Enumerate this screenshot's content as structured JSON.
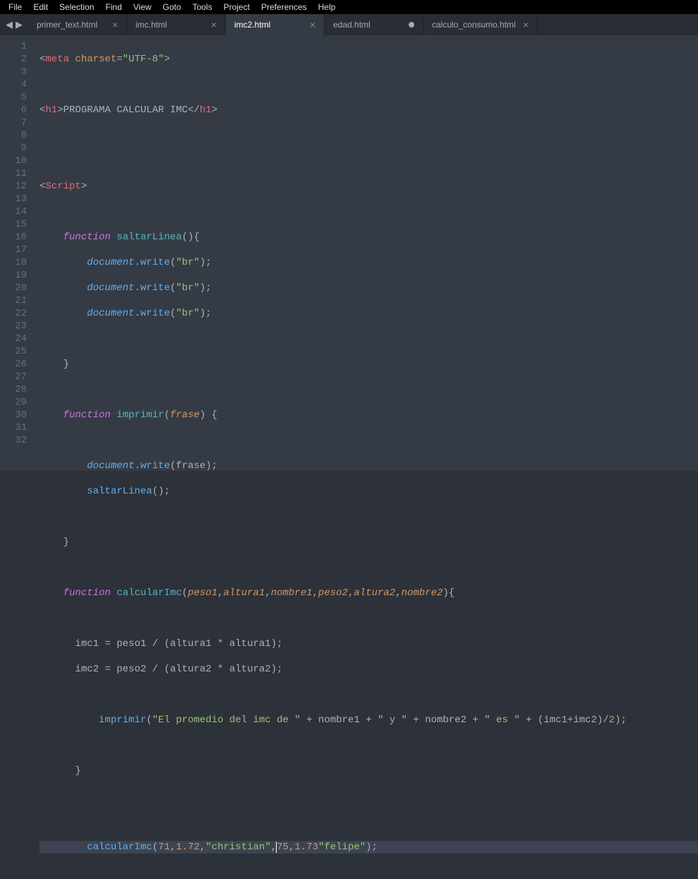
{
  "menu": {
    "items": [
      "File",
      "Edit",
      "Selection",
      "Find",
      "View",
      "Goto",
      "Tools",
      "Project",
      "Preferences",
      "Help"
    ]
  },
  "arrows": {
    "left": "◀",
    "right": "▶"
  },
  "tabs": [
    {
      "label": "primer_text.html",
      "active": false,
      "closeGlyph": "×"
    },
    {
      "label": "imc.html",
      "active": false,
      "closeGlyph": "×"
    },
    {
      "label": "imc2.html",
      "active": true,
      "closeGlyph": "×"
    },
    {
      "label": "edad.html",
      "active": false,
      "dirty": true
    },
    {
      "label": "calculo_consumo.html",
      "active": false,
      "closeGlyph": "×"
    }
  ],
  "code": {
    "ln1": {
      "tag_open": "<",
      "tag": "meta",
      "attr": "charset",
      "eq": "=",
      "q1": "\"",
      "str": "UTF-8",
      "q2": "\"",
      "tag_close": ">"
    },
    "ln3": {
      "open": "<",
      "tag": "h1",
      "bracket": ">",
      "text": "PROGRAMA CALCULAR IMC",
      "close_open": "</",
      "close_tag": "h1",
      "close_bracket": ">"
    },
    "ln6": {
      "open": "<",
      "tag": "Script",
      "bracket": ">"
    },
    "ln8": {
      "kw": "function",
      "name": "saltarLinea",
      "paren": "(){"
    },
    "ln9": {
      "obj": "document",
      "dot": ".",
      "method": "write",
      "call": "(",
      "q": "\"",
      "str": "br",
      "q2": "\"",
      "end": ");"
    },
    "ln10": {
      "obj": "document",
      "dot": ".",
      "method": "write",
      "call": "(",
      "q": "\"",
      "str": "br",
      "q2": "\"",
      "end": ");"
    },
    "ln11": {
      "obj": "document",
      "dot": ".",
      "method": "write",
      "call": "(",
      "q": "\"",
      "str": "br",
      "q2": "\"",
      "end": ");"
    },
    "ln13": {
      "brace": "}"
    },
    "ln15": {
      "kw": "function",
      "name": "imprimir",
      "open": "(",
      "param": "frase",
      "close": ") {"
    },
    "ln17": {
      "obj": "document",
      "dot": ".",
      "method": "write",
      "open": "(",
      "param": "frase",
      "end": ");"
    },
    "ln18": {
      "call": "saltarLinea",
      "end": "();"
    },
    "ln20": {
      "brace": "}"
    },
    "ln22": {
      "kw": "function",
      "name": "calcularImc",
      "open": "(",
      "p1": "peso1",
      "c": ",",
      "p2": "altura1",
      "p3": "nombre1",
      "p4": "peso2",
      "p5": "altura2",
      "p6": "nombre2",
      "close": "){"
    },
    "ln24": {
      "lhs": "imc1",
      "rest": " = peso1 / (altura1 * altura1);"
    },
    "ln25": {
      "lhs": "imc2",
      "rest": " = peso2 / (altura2 * altura2);"
    },
    "ln27": {
      "call": "imprimir",
      "open": "(",
      "s1": "\"El promedio del imc de \"",
      "plus": " + ",
      "v1": "nombre1",
      "s2": "\" y \"",
      "v2": "nombre2",
      "s3": "\" es \"",
      "expr": "(imc1+imc2)/",
      "num": "2",
      "end": ");"
    },
    "ln29": {
      "brace": "}"
    },
    "ln32": {
      "call": "calcularImc",
      "open": "(",
      "n1": "71",
      "c": ",",
      "n2": "1.72",
      "s1": "\"christian\"",
      "n3": "75",
      "n4": "1.73",
      "s2": "\"felipe\"",
      "end": ");"
    }
  },
  "line_count": 32
}
